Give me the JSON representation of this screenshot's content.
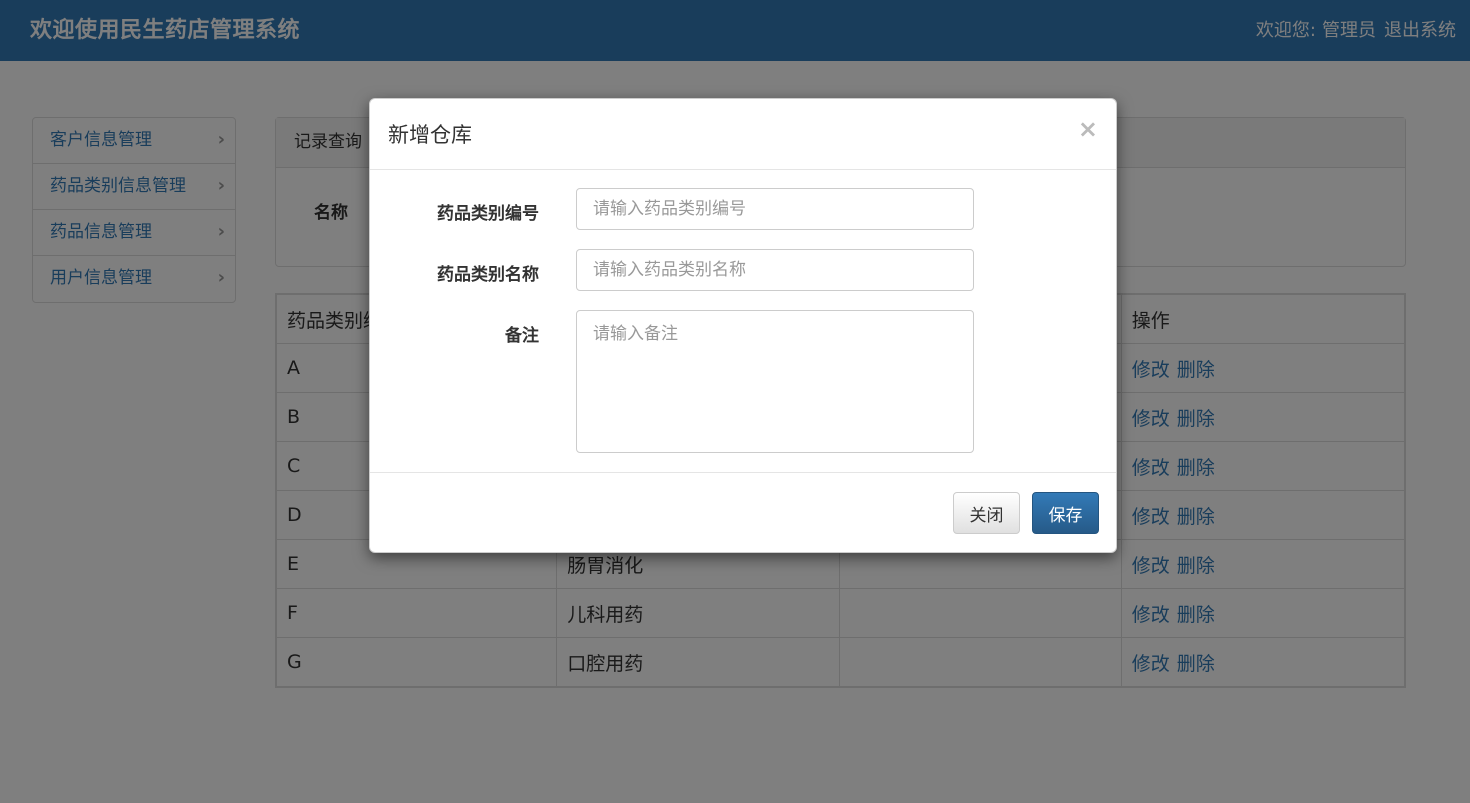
{
  "header": {
    "title": "欢迎使用民生药店管理系统",
    "welcome": "欢迎您:",
    "username": "管理员",
    "logout": "退出系统"
  },
  "sidebar": {
    "items": [
      {
        "label": "客户信息管理"
      },
      {
        "label": "药品类别信息管理"
      },
      {
        "label": "药品信息管理"
      },
      {
        "label": "用户信息管理"
      }
    ]
  },
  "query": {
    "heading": "记录查询",
    "name_label": "名称"
  },
  "table": {
    "col_code": "药品类别编号",
    "col_action": "操作",
    "edit": "修改",
    "delete": "删除",
    "rows": [
      {
        "code": "A",
        "name": ""
      },
      {
        "code": "B",
        "name": ""
      },
      {
        "code": "C",
        "name": ""
      },
      {
        "code": "D",
        "name": ""
      },
      {
        "code": "E",
        "name": "肠胃消化"
      },
      {
        "code": "F",
        "name": "儿科用药"
      },
      {
        "code": "G",
        "name": "口腔用药"
      }
    ]
  },
  "modal": {
    "title": "新增仓库",
    "close_symbol": "×",
    "fields": {
      "code_label": "药品类别编号",
      "code_placeholder": "请输入药品类别编号",
      "name_label": "药品类别名称",
      "name_placeholder": "请输入药品类别名称",
      "remark_label": "备注",
      "remark_placeholder": "请输入备注"
    },
    "close_button": "关闭",
    "save_button": "保存"
  }
}
